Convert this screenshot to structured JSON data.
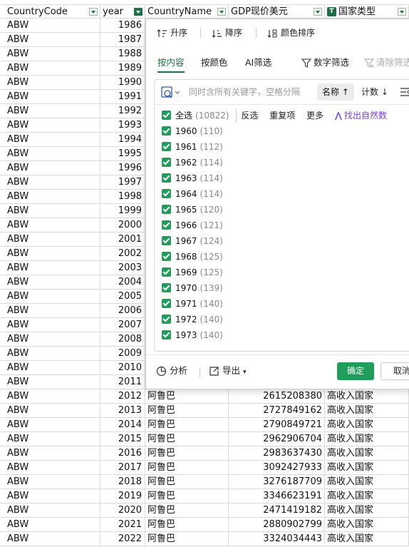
{
  "sheet": {
    "headers": [
      "CountryCode",
      "year",
      "CountryName",
      "GDP现价美元",
      "国家类型"
    ],
    "rows": [
      [
        "ABW",
        "1986",
        "",
        "",
        ""
      ],
      [
        "ABW",
        "1987",
        "",
        "",
        ""
      ],
      [
        "ABW",
        "1988",
        "",
        "",
        ""
      ],
      [
        "ABW",
        "1989",
        "",
        "",
        ""
      ],
      [
        "ABW",
        "1990",
        "",
        "",
        ""
      ],
      [
        "ABW",
        "1991",
        "",
        "",
        ""
      ],
      [
        "ABW",
        "1992",
        "",
        "",
        ""
      ],
      [
        "ABW",
        "1993",
        "",
        "",
        ""
      ],
      [
        "ABW",
        "1994",
        "",
        "",
        ""
      ],
      [
        "ABW",
        "1995",
        "",
        "",
        ""
      ],
      [
        "ABW",
        "1996",
        "",
        "",
        ""
      ],
      [
        "ABW",
        "1997",
        "",
        "",
        ""
      ],
      [
        "ABW",
        "1998",
        "",
        "",
        ""
      ],
      [
        "ABW",
        "1999",
        "",
        "",
        ""
      ],
      [
        "ABW",
        "2000",
        "",
        "",
        ""
      ],
      [
        "ABW",
        "2001",
        "",
        "",
        ""
      ],
      [
        "ABW",
        "2002",
        "",
        "",
        ""
      ],
      [
        "ABW",
        "2003",
        "",
        "",
        ""
      ],
      [
        "ABW",
        "2004",
        "",
        "",
        ""
      ],
      [
        "ABW",
        "2005",
        "",
        "",
        ""
      ],
      [
        "ABW",
        "2006",
        "",
        "",
        ""
      ],
      [
        "ABW",
        "2007",
        "",
        "",
        ""
      ],
      [
        "ABW",
        "2008",
        "",
        "",
        ""
      ],
      [
        "ABW",
        "2009",
        "",
        "",
        ""
      ],
      [
        "ABW",
        "2010",
        "",
        "",
        ""
      ],
      [
        "ABW",
        "2011",
        "",
        "",
        ""
      ],
      [
        "ABW",
        "2012",
        "阿鲁巴",
        "2615208380",
        "高收入国家"
      ],
      [
        "ABW",
        "2013",
        "阿鲁巴",
        "2727849162",
        "高收入国家"
      ],
      [
        "ABW",
        "2014",
        "阿鲁巴",
        "2790849721",
        "高收入国家"
      ],
      [
        "ABW",
        "2015",
        "阿鲁巴",
        "2962906704",
        "高收入国家"
      ],
      [
        "ABW",
        "2016",
        "阿鲁巴",
        "2983637430",
        "高收入国家"
      ],
      [
        "ABW",
        "2017",
        "阿鲁巴",
        "3092427933",
        "高收入国家"
      ],
      [
        "ABW",
        "2018",
        "阿鲁巴",
        "3276187709",
        "高收入国家"
      ],
      [
        "ABW",
        "2019",
        "阿鲁巴",
        "3346623191",
        "高收入国家"
      ],
      [
        "ABW",
        "2020",
        "阿鲁巴",
        "2471419182",
        "高收入国家"
      ],
      [
        "ABW",
        "2021",
        "阿鲁巴",
        "2880902799",
        "高收入国家"
      ],
      [
        "ABW",
        "2022",
        "阿鲁巴",
        "3324034443",
        "高收入国家"
      ]
    ]
  },
  "panel": {
    "sort": {
      "asc": "升序",
      "desc": "降序",
      "color": "颜色排序"
    },
    "tabs": {
      "content": "按内容",
      "color": "按颜色",
      "ai": "AI筛选",
      "number": "数字筛选",
      "clear": "清除筛选"
    },
    "search": {
      "placeholder": "同时含所有关键字，空格分隔",
      "sort_name": "名称",
      "sort_count": "计数"
    },
    "select_all": {
      "label": "全选",
      "count": "(10822)"
    },
    "actions": {
      "invert": "反选",
      "duplicates": "重复项",
      "more": "更多",
      "ai_find": "找出自然数"
    },
    "items": [
      {
        "label": "1960",
        "count": "(110)"
      },
      {
        "label": "1961",
        "count": "(112)"
      },
      {
        "label": "1962",
        "count": "(114)"
      },
      {
        "label": "1963",
        "count": "(114)"
      },
      {
        "label": "1964",
        "count": "(114)"
      },
      {
        "label": "1965",
        "count": "(120)"
      },
      {
        "label": "1966",
        "count": "(121)"
      },
      {
        "label": "1967",
        "count": "(124)"
      },
      {
        "label": "1968",
        "count": "(125)"
      },
      {
        "label": "1969",
        "count": "(125)"
      },
      {
        "label": "1970",
        "count": "(139)"
      },
      {
        "label": "1971",
        "count": "(140)"
      },
      {
        "label": "1972",
        "count": "(140)"
      },
      {
        "label": "1973",
        "count": "(140)"
      }
    ],
    "footer": {
      "analyze": "分析",
      "export": "导出",
      "ok": "确定",
      "cancel": "取消"
    }
  },
  "colors": {
    "accent": "#1e9e5a",
    "tab_active": "#1e7145",
    "ai_purple": "#7b3fe4"
  }
}
